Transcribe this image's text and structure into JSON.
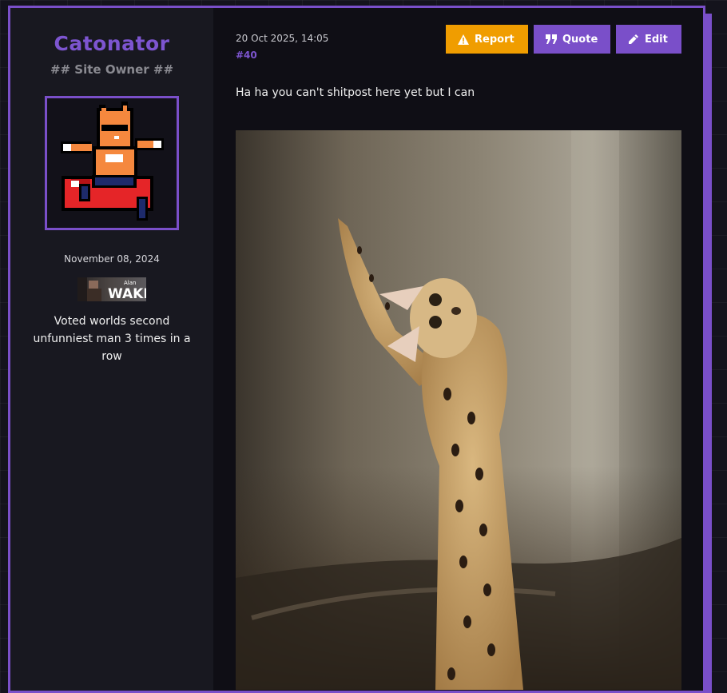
{
  "user": {
    "name": "Catonator",
    "rank": "## Site Owner ##",
    "join_date": "November 08, 2024",
    "userbar": {
      "title_small": "Alan",
      "title_large": "WAKE"
    },
    "bio": "Voted worlds second unfunniest man 3 times in a row"
  },
  "post": {
    "date": "20 Oct 2025, 14:05",
    "number": "#40",
    "message": "Ha ha you can't shitpost here yet but I can",
    "image_icon": "serval-photo"
  },
  "actions": {
    "report_label": "Report",
    "quote_label": "Quote",
    "edit_label": "Edit",
    "report_icon": "warning-icon",
    "quote_icon": "quote-icon",
    "edit_icon": "pencil-icon"
  },
  "colors": {
    "accent": "#7a4fc9",
    "report": "#f09d00",
    "panel": "#181820",
    "background": "#0f0e15"
  }
}
